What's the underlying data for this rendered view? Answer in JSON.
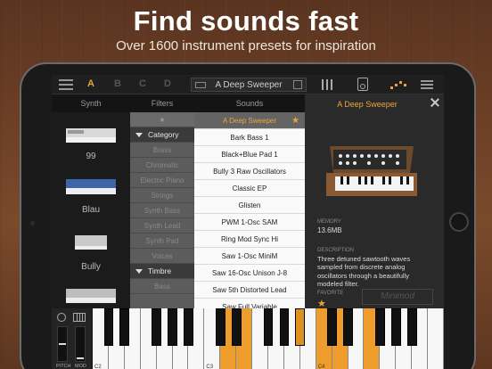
{
  "promo": {
    "headline": "Find sounds fast",
    "subline": "Over 1600 instrument presets for inspiration"
  },
  "topbar": {
    "slots": [
      "A",
      "B",
      "C",
      "D"
    ],
    "active_slot": "A",
    "preset_name": "A Deep Sweeper",
    "icons": [
      "menu-icon",
      "keyboard-icon",
      "save-icon",
      "mixer-icon",
      "amp-icon",
      "arpeggiator-icon",
      "more-menu-icon"
    ]
  },
  "columns": {
    "synth": "Synth",
    "filters": "Filters",
    "sounds": "Sounds",
    "detail": "A Deep Sweeper"
  },
  "synths": [
    {
      "label": "99"
    },
    {
      "label": "Blau"
    },
    {
      "label": "Bully"
    },
    {
      "label": ""
    }
  ],
  "filters": {
    "star": "★",
    "category_title": "Category",
    "categories": [
      "Brass",
      "Chromatic",
      "Electric Piano",
      "Strings",
      "Synth Bass",
      "Synth Lead",
      "Synth Pad",
      "Voices"
    ],
    "timbre_title": "Timbre",
    "timbre_items": [
      "Bass"
    ]
  },
  "sounds": [
    {
      "name": "A Deep Sweeper",
      "selected": true,
      "favorite": true
    },
    {
      "name": "Bark Bass 1"
    },
    {
      "name": "Black+Blue Pad 1"
    },
    {
      "name": "Bully 3 Raw Oscillators"
    },
    {
      "name": "Classic EP"
    },
    {
      "name": "Glisten"
    },
    {
      "name": "PWM 1-Osc SAM"
    },
    {
      "name": "Ring Mod Sync Hi"
    },
    {
      "name": "Saw 1-Osc MiniM"
    },
    {
      "name": "Saw 16-Osc Unison J-8"
    },
    {
      "name": "Saw 5th Distorted Lead"
    },
    {
      "name": "Saw Full Variable"
    }
  ],
  "detail": {
    "memory_label": "MEMORY",
    "memory_value": "13.6MB",
    "description_label": "DESCRIPTION",
    "description": "Three detuned sawtooth waves sampled from discrete analog oscillators through a beautifully modeled filter.",
    "favorite_label": "FAVORITE",
    "favorite_star": "★",
    "logo_text": "Minimod"
  },
  "keyboard": {
    "pitch_label": "PITCH",
    "mod_label": "MOD",
    "octave_labels": [
      "C2",
      "C3",
      "C4"
    ],
    "lit_white_keys": [
      8,
      9,
      14,
      15,
      17
    ],
    "lit_black_keys": [
      9
    ]
  },
  "colors": {
    "accent": "#f0a33a",
    "key_highlight": "#ee9d2c",
    "filter_bg": "#5c5c5c",
    "sounds_bg": "#fafafa"
  }
}
